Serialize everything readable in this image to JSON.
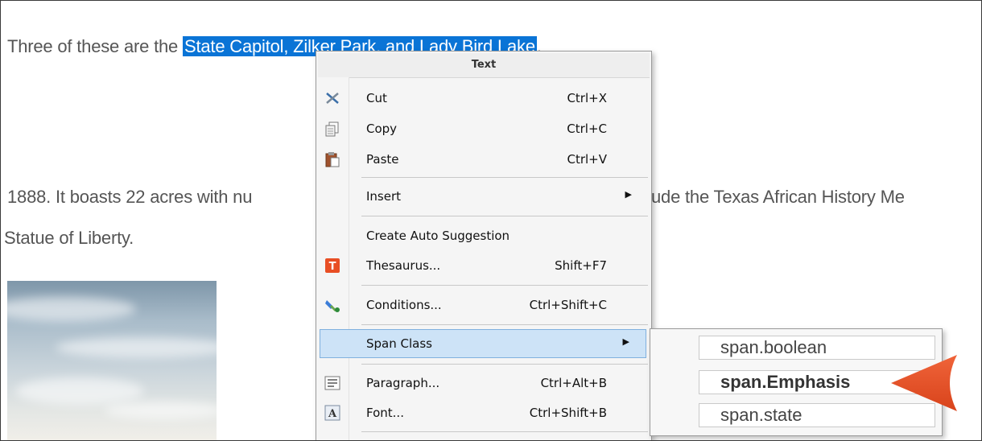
{
  "document": {
    "line1_pre": "Three of these are the ",
    "line1_selected": "State Capitol, Zilker Park, and Lady Bird Lake",
    "line1_post": ".",
    "line2_left": "1888. It boasts 22 acres with nu",
    "line2_right": "ude the Texas African History Me",
    "line3": "Statue of Liberty."
  },
  "context_menu": {
    "title": "Text",
    "items": [
      {
        "label": "Cut",
        "shortcut": "Ctrl+X",
        "icon": "scissors-icon"
      },
      {
        "label": "Copy",
        "shortcut": "Ctrl+C",
        "icon": "copy-icon"
      },
      {
        "label": "Paste",
        "shortcut": "Ctrl+V",
        "icon": "paste-icon"
      },
      {
        "label": "Insert",
        "shortcut": "",
        "submenu": true
      },
      {
        "label": "Create Auto Suggestion",
        "shortcut": ""
      },
      {
        "label": "Thesaurus...",
        "shortcut": "Shift+F7",
        "icon": "thesaurus-icon"
      },
      {
        "label": "Conditions...",
        "shortcut": "Ctrl+Shift+C",
        "icon": "conditions-icon"
      },
      {
        "label": "Span Class",
        "shortcut": "",
        "submenu": true,
        "highlighted": true
      },
      {
        "label": "Paragraph...",
        "shortcut": "Ctrl+Alt+B",
        "icon": "paragraph-icon"
      },
      {
        "label": "Font...",
        "shortcut": "Ctrl+Shift+B",
        "icon": "font-icon"
      }
    ]
  },
  "span_class_submenu": {
    "items": [
      {
        "label": "span.boolean",
        "emphasized": false
      },
      {
        "label": "span.Emphasis",
        "emphasized": true
      },
      {
        "label": "span.state",
        "emphasized": false
      }
    ]
  },
  "colors": {
    "selection": "#0a74d6",
    "highlight": "#cde3f7",
    "pointer": "#e8522a"
  }
}
